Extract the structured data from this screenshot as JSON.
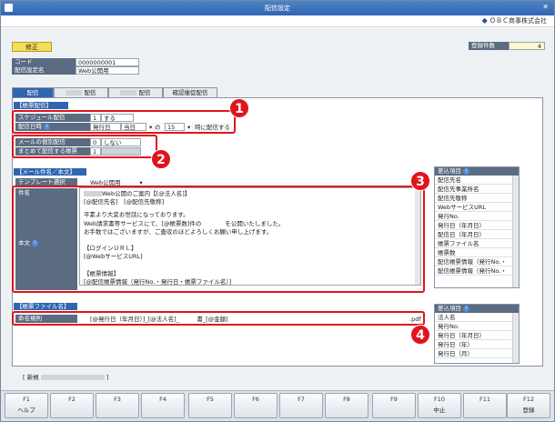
{
  "window": {
    "title": "配信設定",
    "company": "ＯＢＣ商事株式会社"
  },
  "header": {
    "mode_button": "修正",
    "reg_count_label": "登録件数",
    "reg_count_value": "4",
    "code_label": "コード",
    "code_value": "0000000001",
    "name_label": "配信設定名",
    "name_value": "Web公開用"
  },
  "tabs": [
    "配信",
    "配信",
    "配信",
    "確認催促配信"
  ],
  "delivery": {
    "section": "【帳票配信】",
    "schedule_label": "スケジュール配信",
    "schedule_num": "1",
    "schedule_value": "する",
    "datetime_label": "配信日時",
    "dt_base": "発行日",
    "dt_day": "当日",
    "dt_no": "の",
    "dt_hour": "15",
    "dt_suffix": "時に配信する",
    "mail_label": "メールの個別配信",
    "mail_num": "0",
    "mail_value": "しない",
    "bundle_label": "まとめて配信する帳票",
    "bundle_num": "1"
  },
  "mail": {
    "section": "【メール件名／本文】",
    "template_label": "テンプレート選択",
    "template_value": "Web公開用",
    "subject_label": "件名",
    "body_label": "本文",
    "subject_line1": "Web公開のご案内【[@法人名]】",
    "subject_line2": "[@配信先名]　[@配信先敬称]",
    "body_lines": [
      "平素より大変お世話になっております。",
      "Web請求書等サービスにて、[@帳票数]件の　　　　を公開いたしました。",
      "お手数ではございますが、ご査収のほどよろしくお願い申し上げます。",
      "",
      "【ログインＵＲＬ】",
      "[@WebサービスURL]",
      "",
      "【帳票情報】",
      "[@配信帳票情報（発行No.・発行日・帳票ファイル名）]"
    ]
  },
  "diff_items_1": {
    "title": "差込項目",
    "items": [
      "配信先名",
      "配信先事業所名",
      "配信先敬称",
      "WebサービスURL",
      "発行No.",
      "発行日（年月日）",
      "配信日（年月日）",
      "帳票ファイル名",
      "帳票数",
      "配信帳票情報（発行No.・",
      "配信帳票情報（発行No.・"
    ]
  },
  "file": {
    "section": "【帳票ファイル名】",
    "naming_label": "命名規則",
    "naming_value": "[@発行日（年月日）]_[@法人名]_　　　書_[@金額]",
    "ext": ".pdf"
  },
  "diff_items_2": {
    "title": "差込項目",
    "items": [
      "法人名",
      "発行No.",
      "発行日（年月日）",
      "発行日（年）",
      "発行日（月）"
    ]
  },
  "footer_status": "[ 新規",
  "footer_end": "]",
  "badges": [
    "1",
    "2",
    "3",
    "4"
  ],
  "fkeys": [
    {
      "k": "F1",
      "l": "ヘルプ"
    },
    {
      "k": "F2",
      "l": ""
    },
    {
      "k": "F3",
      "l": ""
    },
    {
      "k": "F4",
      "l": ""
    },
    {
      "k": "F5",
      "l": ""
    },
    {
      "k": "F6",
      "l": ""
    },
    {
      "k": "F7",
      "l": ""
    },
    {
      "k": "F8",
      "l": ""
    },
    {
      "k": "F9",
      "l": ""
    },
    {
      "k": "F10",
      "l": "中止"
    },
    {
      "k": "F11",
      "l": ""
    },
    {
      "k": "F12",
      "l": "登録"
    }
  ]
}
